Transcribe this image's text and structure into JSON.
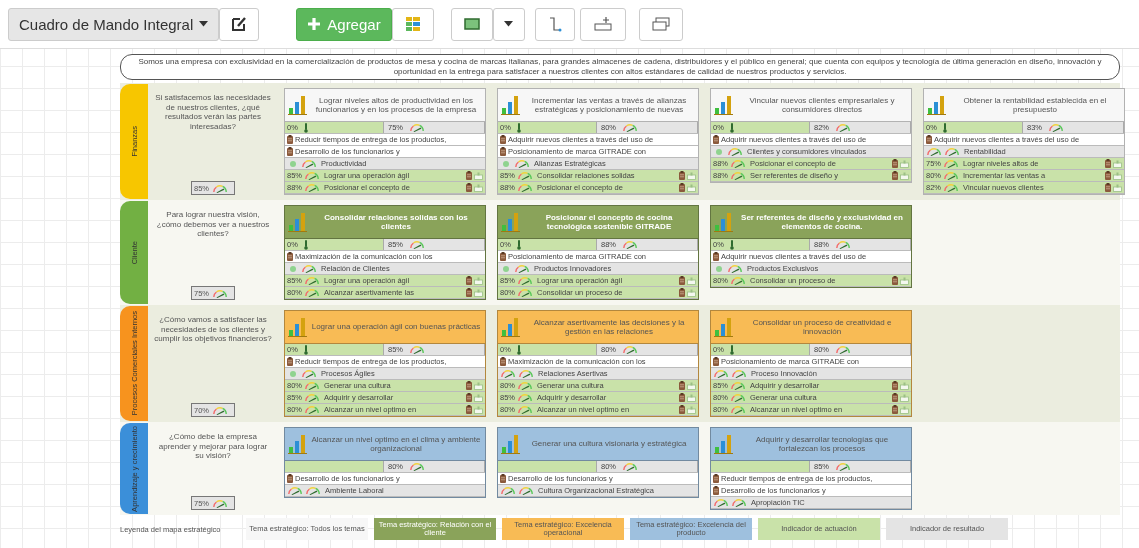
{
  "toolbar": {
    "map_selector": "Cuadro de Mando Integral",
    "add_button": "Agregar"
  },
  "mission": "Somos una empresa con exclusividad en la comercialización de productos de mesa y cocina de marcas italianas, para grandes almacenes de cadena, distribuidores y el público en general; que cuenta con equipos y tecnología de última generación en diseño, innovación y oportunidad en la entrega para satisfacer a nuestros clientes con altos estándares de calidad de nuestros productos y servicios.",
  "perspectives": [
    {
      "name": "Finanzas",
      "color": "#f7c600",
      "question": "Si satisfacemos las necesidades de nuestros clientes, ¿qué resultados verán las partes interesadas?",
      "gauge": "85%",
      "objectives": [
        {
          "title": "Lograr niveles altos de productividad en los funcionarios y en los procesos de la empresa",
          "color": "#f7f7f7",
          "progress": "0%",
          "gauge": "75%",
          "initiatives": [
            "Reducir tiempos de entrega de los productos,",
            "Desarrollo de los funcionarios y"
          ],
          "indicator": {
            "name": "Productividad",
            "status_dot": true
          },
          "links": [
            {
              "percent": "85%",
              "text": "Lograr una operación ágil"
            },
            {
              "percent": "88%",
              "text": "Posicionar el concepto de"
            }
          ]
        },
        {
          "title": "Incrementar las ventas a través de alianzas estratégicas y posicionamiento de nuevas",
          "color": "#f7f7f7",
          "progress": "0%",
          "gauge": "80%",
          "initiatives": [
            "Adquirir nuevos clientes a través del uso de",
            "Posicionamiento de marca GITRADE con"
          ],
          "indicator": {
            "name": "Alianzas Estratégicas",
            "status_dot": true
          },
          "links": [
            {
              "percent": "85%",
              "text": "Consolidar relaciones solidas"
            },
            {
              "percent": "88%",
              "text": "Posicionar el concepto de"
            }
          ]
        },
        {
          "title": "Vincular nuevos clientes empresariales y consumidores directos",
          "color": "#f7f7f7",
          "progress": "0%",
          "gauge": "82%",
          "initiatives": [
            "Adquirir nuevos clientes a través del uso de"
          ],
          "indicator": {
            "name": "Clientes y consumidores vinculados",
            "status_dot": true
          },
          "links": [
            {
              "percent": "88%",
              "text": "Posicionar el concepto de"
            },
            {
              "percent": "88%",
              "text": "Ser referentes de diseño y"
            }
          ]
        },
        {
          "title": "Obtener la rentabilidad establecida en el presupuesto",
          "color": "#f7f7f7",
          "progress": "0%",
          "gauge": "83%",
          "initiatives": [
            "Adquirir nuevos clientes a través del uso de"
          ],
          "indicator": {
            "name": "Rentabilidad",
            "status_dot": false
          },
          "links": [
            {
              "percent": "75%",
              "text": "Lograr niveles altos de"
            },
            {
              "percent": "80%",
              "text": "Incrementar las ventas a"
            },
            {
              "percent": "82%",
              "text": "Vincular nuevos clientes"
            }
          ]
        }
      ]
    },
    {
      "name": "Cliente",
      "color": "#72b043",
      "question": "Para lograr nuestra visión, ¿cómo debemos ver a nuestros clientes?",
      "gauge": "75%",
      "objectives": [
        {
          "title": "Consolidar relaciones solidas con los clientes",
          "color": "#8aa35a",
          "progress": "0%",
          "gauge": "85%",
          "initiatives": [
            "Maximización de la comunicación con los"
          ],
          "indicator": {
            "name": "Relación de Clientes",
            "status_dot": true
          },
          "links": [
            {
              "percent": "85%",
              "text": "Lograr una operación ágil"
            },
            {
              "percent": "80%",
              "text": "Alcanzar asertivamente las"
            }
          ]
        },
        {
          "title": "Posicionar el concepto de cocina tecnológica sostenible GITRADE",
          "color": "#8aa35a",
          "progress": "0%",
          "gauge": "88%",
          "initiatives": [
            "Posicionamiento de marca GITRADE con"
          ],
          "indicator": {
            "name": "Productos Innovadores",
            "status_dot": true
          },
          "links": [
            {
              "percent": "85%",
              "text": "Lograr una operación ágil"
            },
            {
              "percent": "80%",
              "text": "Consolidar un proceso de"
            }
          ]
        },
        {
          "title": "Ser referentes de diseño y exclusividad en elementos de cocina.",
          "color": "#8aa35a",
          "progress": "0%",
          "gauge": "88%",
          "initiatives": [
            "Adquirir nuevos clientes a través del uso de"
          ],
          "indicator": {
            "name": "Productos Exclusivos",
            "status_dot": true
          },
          "links": [
            {
              "percent": "80%",
              "text": "Consolidar un proceso de"
            }
          ]
        }
      ]
    },
    {
      "name": "Procesos Comerciales Internos",
      "color": "#f7931e",
      "question": "¿Cómo vamos a satisfacer las necesidades de los clientes y cumplir los objetivos financieros?",
      "gauge": "70%",
      "objectives": [
        {
          "title": "Lograr una operación ágil con buenas prácticas",
          "color": "#f8bb55",
          "progress": "0%",
          "gauge": "85%",
          "initiatives": [
            "Reducir tiempos de entrega de los productos,"
          ],
          "indicator": {
            "name": "Procesos Ágiles",
            "status_dot": true
          },
          "links": [
            {
              "percent": "80%",
              "text": "Generar una cultura"
            },
            {
              "percent": "85%",
              "text": "Adquirir y desarrollar"
            },
            {
              "percent": "80%",
              "text": "Alcanzar un nivel optimo en"
            }
          ]
        },
        {
          "title": "Alcanzar asertivamente las decisiones y la gestión en las relaciones",
          "color": "#f8bb55",
          "progress": "0%",
          "gauge": "80%",
          "initiatives": [
            "Maximización de la comunicación con los"
          ],
          "indicator": {
            "name": "Relaciones Asertivas",
            "status_dot": false
          },
          "links": [
            {
              "percent": "80%",
              "text": "Generar una cultura"
            },
            {
              "percent": "85%",
              "text": "Adquirir y desarrollar"
            },
            {
              "percent": "80%",
              "text": "Alcanzar un nivel optimo en"
            }
          ]
        },
        {
          "title": "Consolidar un proceso de creatividad e innovación",
          "color": "#f8bb55",
          "progress": "0%",
          "gauge": "80%",
          "initiatives": [
            "Posicionamiento de marca GITRADE con"
          ],
          "indicator": {
            "name": "Proceso Innovación",
            "status_dot": false
          },
          "links": [
            {
              "percent": "85%",
              "text": "Adquirir y desarrollar"
            },
            {
              "percent": "80%",
              "text": "Generar una cultura"
            },
            {
              "percent": "80%",
              "text": "Alcanzar un nivel optimo en"
            }
          ]
        }
      ]
    },
    {
      "name": "Aprendizaje y crecimiento",
      "color": "#3b8fd9",
      "question": "¿Cómo debe la empresa aprender y mejorar para lograr su visión?",
      "gauge": "75%",
      "objectives": [
        {
          "title": "Alcanzar un nivel optimo en el clima y ambiente organizacional",
          "color": "#9ec0de",
          "gauge": "80%",
          "initiatives": [
            "Desarrollo de los funcionarios y"
          ],
          "indicator": {
            "name": "Ambiente Laboral",
            "status_dot": false
          }
        },
        {
          "title": "Generar una cultura visionaria y estratégica",
          "color": "#9ec0de",
          "gauge": "80%",
          "initiatives": [
            "Desarrollo de los funcionarios y"
          ],
          "indicator": {
            "name": "Cultura Organizacional Estratégica",
            "status_dot": false
          }
        },
        {
          "title": "Adquirir y desarrollar tecnologías que fortalezcan los procesos",
          "color": "#9ec0de",
          "gauge": "85%",
          "initiatives": [
            "Reducir tiempos de entrega de los productos,",
            "Desarrollo de los funcionarios y"
          ],
          "indicator": {
            "name": "Apropiación TIC",
            "status_dot": false
          }
        }
      ]
    }
  ],
  "legend": {
    "title": "Leyenda del mapa estratégico",
    "items": [
      {
        "label": "Tema estratégico: Todos los temas",
        "color": "#f7f7f7"
      },
      {
        "label": "Tema estratégico: Relación con el cliente",
        "color": "#8aa35a"
      },
      {
        "label": "Tema estratégico: Excelencia operacional",
        "color": "#f8bb55"
      },
      {
        "label": "Tema estratégico: Excelencia del producto",
        "color": "#9ec0de"
      },
      {
        "label": "Indicador de actuación",
        "color": "#c9e2a9"
      },
      {
        "label": "Indicador de resultado",
        "color": "#e4e4e4"
      }
    ]
  }
}
